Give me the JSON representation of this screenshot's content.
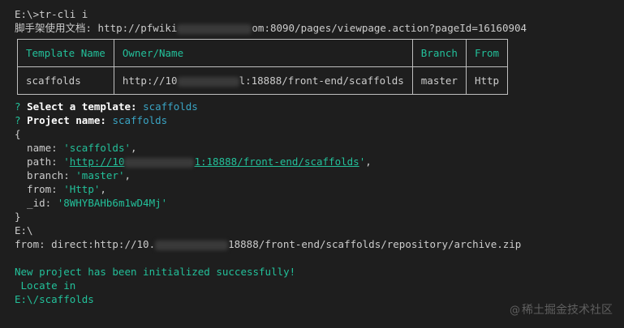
{
  "terminal": {
    "command_line": "E:\\>tr-cli i",
    "doc_line": {
      "prefix": "脚手架使用文档: http://pfwiki",
      "suffix": "om:8090/pages/viewpage.action?pageId=16160904"
    },
    "table": {
      "headers": [
        "Template Name",
        "Owner/Name",
        "Branch",
        "From"
      ],
      "row": {
        "name": "scaffolds",
        "owner_prefix": "http://10",
        "owner_suffix": "l:18888/front-end/scaffolds",
        "branch": "master",
        "from": "Http"
      }
    },
    "prompts": [
      {
        "mark": "?",
        "label": "Select a template:",
        "value": "scaffolds"
      },
      {
        "mark": "?",
        "label": "Project name:",
        "value": "scaffolds"
      }
    ],
    "object": {
      "open": "{",
      "close": "}",
      "name_key": "  name: ",
      "name_value": "'scaffolds'",
      "path_key": "  path: ",
      "path_value_prefix": "http://10",
      "path_value_suffix": "1:18888/front-end/scaffolds",
      "branch_key": "  branch: ",
      "branch_value": "'master'",
      "from_key": "  from: ",
      "from_value": "'Http'",
      "id_key": "  _id: ",
      "id_value": "'8WHYBAHb6m1wD4Mj'"
    },
    "cwd_line": "E:\\",
    "from_line": {
      "prefix": "from: direct:http://10.",
      "suffix": "18888/front-end/scaffolds/repository/archive.zip"
    },
    "success_line": "New project has been initialized successfully!",
    "locate_line": " Locate in",
    "final_path": "E:\\/scaffolds"
  },
  "watermark": {
    "at": "@",
    "text": "稀土掘金技术社区"
  },
  "colors": {
    "background": "#1e1e1e",
    "text": "#cccccc",
    "accent_green": "#23c09a",
    "accent_cyan": "#3aa4c4"
  }
}
